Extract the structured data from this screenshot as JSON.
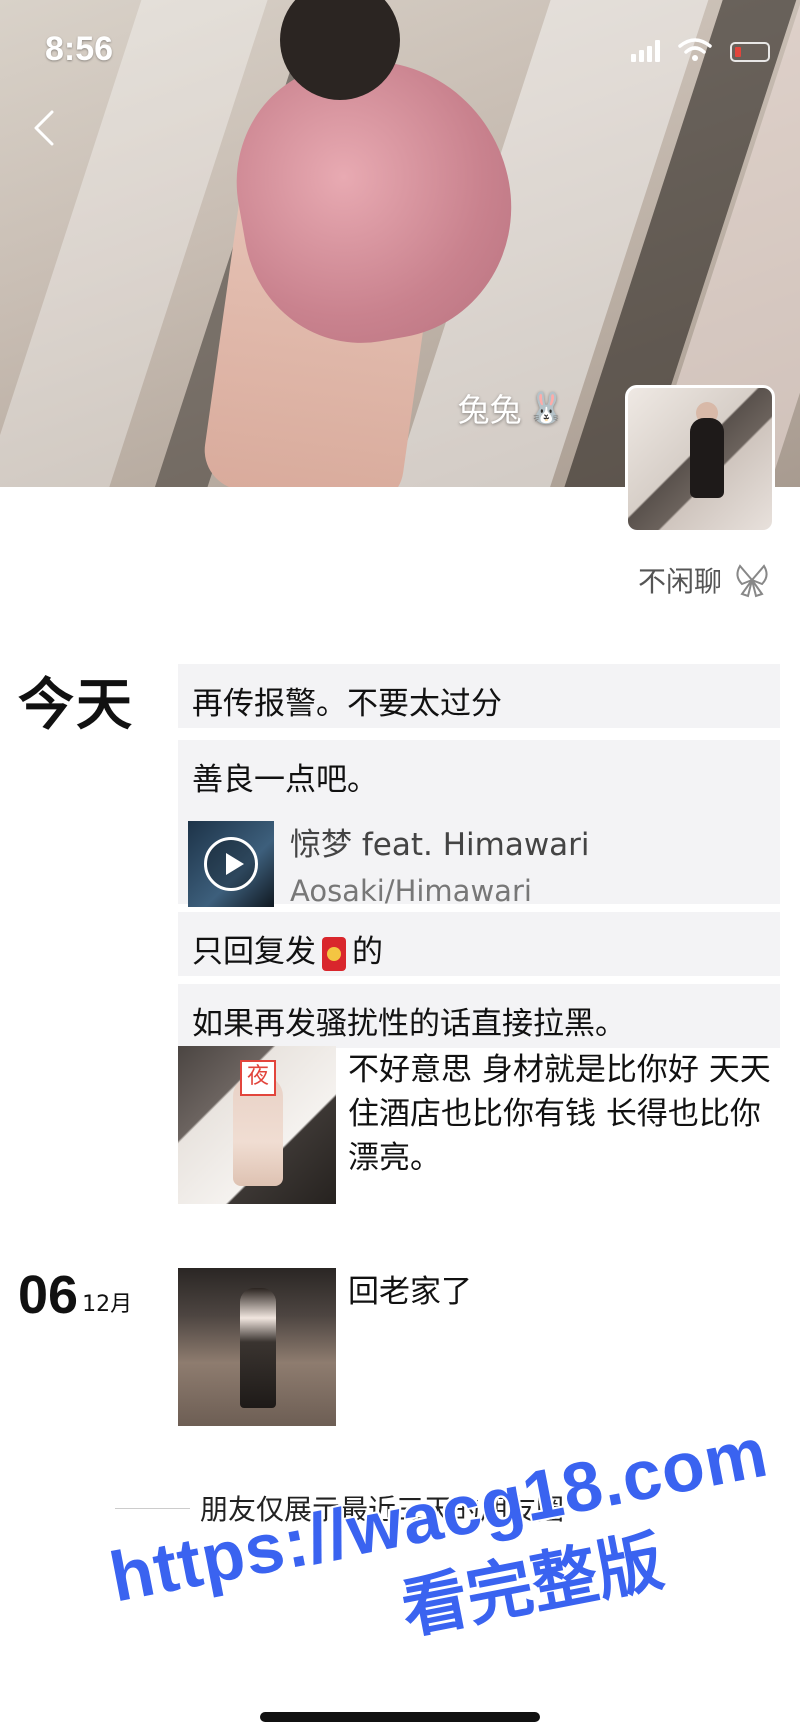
{
  "status_bar": {
    "time": "8:56"
  },
  "profile": {
    "nickname": "兔兔",
    "nickname_icon": "rabbit-icon",
    "signature": "不闲聊",
    "signature_icon": "butterfly-icon"
  },
  "feed": {
    "today_label": "今天",
    "posts": [
      {
        "text": "再传报警。不要太过分"
      },
      {
        "text": "善良一点吧。",
        "music": {
          "title": "惊梦 feat. Himawari",
          "artist": "Aosaki/Himawari"
        }
      },
      {
        "text_before": "只回复发",
        "text_after": "的"
      },
      {
        "text": "如果再发骚扰性的话直接拉黑。"
      },
      {
        "text": "不好意思 身材就是比你好 天天住酒店也比你有钱 长得也比你漂亮。",
        "thumb_tag": "夜"
      }
    ],
    "dated": {
      "day": "06",
      "month": "12月",
      "text": "回老家了"
    },
    "footer": "朋友仅展示最近三天的朋友圈"
  },
  "watermark": {
    "url": "https://wacg18.com",
    "subtitle": "看完整版"
  },
  "colors": {
    "watermark": "#3a63f0",
    "post_bg": "#f3f3f5",
    "red_packet": "#d9262c"
  }
}
